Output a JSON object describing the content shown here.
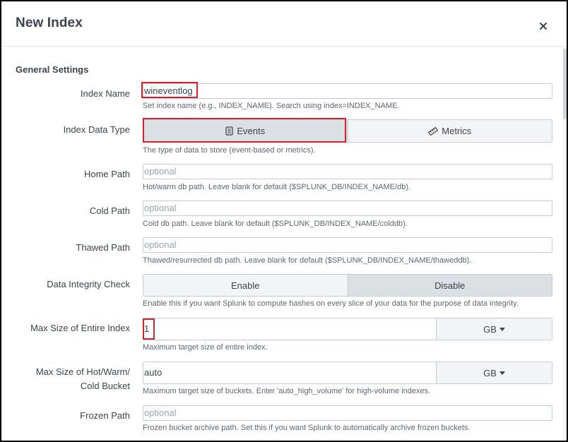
{
  "dialog": {
    "title": "New Index",
    "close_icon": "close-icon"
  },
  "section": {
    "title": "General Settings"
  },
  "index_name": {
    "label": "Index Name",
    "value": "wineventlog",
    "help": "Set index name (e.g., INDEX_NAME). Search using index=INDEX_NAME."
  },
  "index_data_type": {
    "label": "Index Data Type",
    "options": [
      {
        "label": "Events",
        "icon": "document-icon",
        "selected": true
      },
      {
        "label": "Metrics",
        "icon": "ruler-icon",
        "selected": false
      }
    ],
    "help": "The type of data to store (event-based or metrics)."
  },
  "home_path": {
    "label": "Home Path",
    "placeholder": "optional",
    "help": "Hot/warm db path. Leave blank for default ($SPLUNK_DB/INDEX_NAME/db)."
  },
  "cold_path": {
    "label": "Cold Path",
    "placeholder": "optional",
    "help": "Cold db path. Leave blank for default ($SPLUNK_DB/INDEX_NAME/colddb)."
  },
  "thawed_path": {
    "label": "Thawed Path",
    "placeholder": "optional",
    "help": "Thawed/resurrected db path. Leave blank for default ($SPLUNK_DB/INDEX_NAME/thaweddb)."
  },
  "data_integrity": {
    "label": "Data Integrity Check",
    "options": [
      {
        "label": "Enable",
        "selected": false
      },
      {
        "label": "Disable",
        "selected": true
      }
    ],
    "help": "Enable this if you want Splunk to compute hashes on every slice of your data for the purpose of data integrity."
  },
  "max_size": {
    "label": "Max Size of Entire Index",
    "value": "1",
    "unit": "GB",
    "help": "Maximum target size of entire index."
  },
  "max_bucket": {
    "label_line1": "Max Size of Hot/Warm/",
    "label_line2": "Cold Bucket",
    "value": "auto",
    "unit": "GB",
    "help": "Maximum target size of buckets. Enter 'auto_high_volume' for high-volume indexes."
  },
  "frozen_path": {
    "label": "Frozen Path",
    "placeholder": "optional",
    "help": "Frozen bucket archive path. Set this if you want Splunk to automatically archive frozen buckets."
  },
  "colors": {
    "highlight": "#d6202a",
    "text": "#3c444d",
    "border": "#c3cbd4",
    "selected_segment": "#dbe0e4"
  }
}
